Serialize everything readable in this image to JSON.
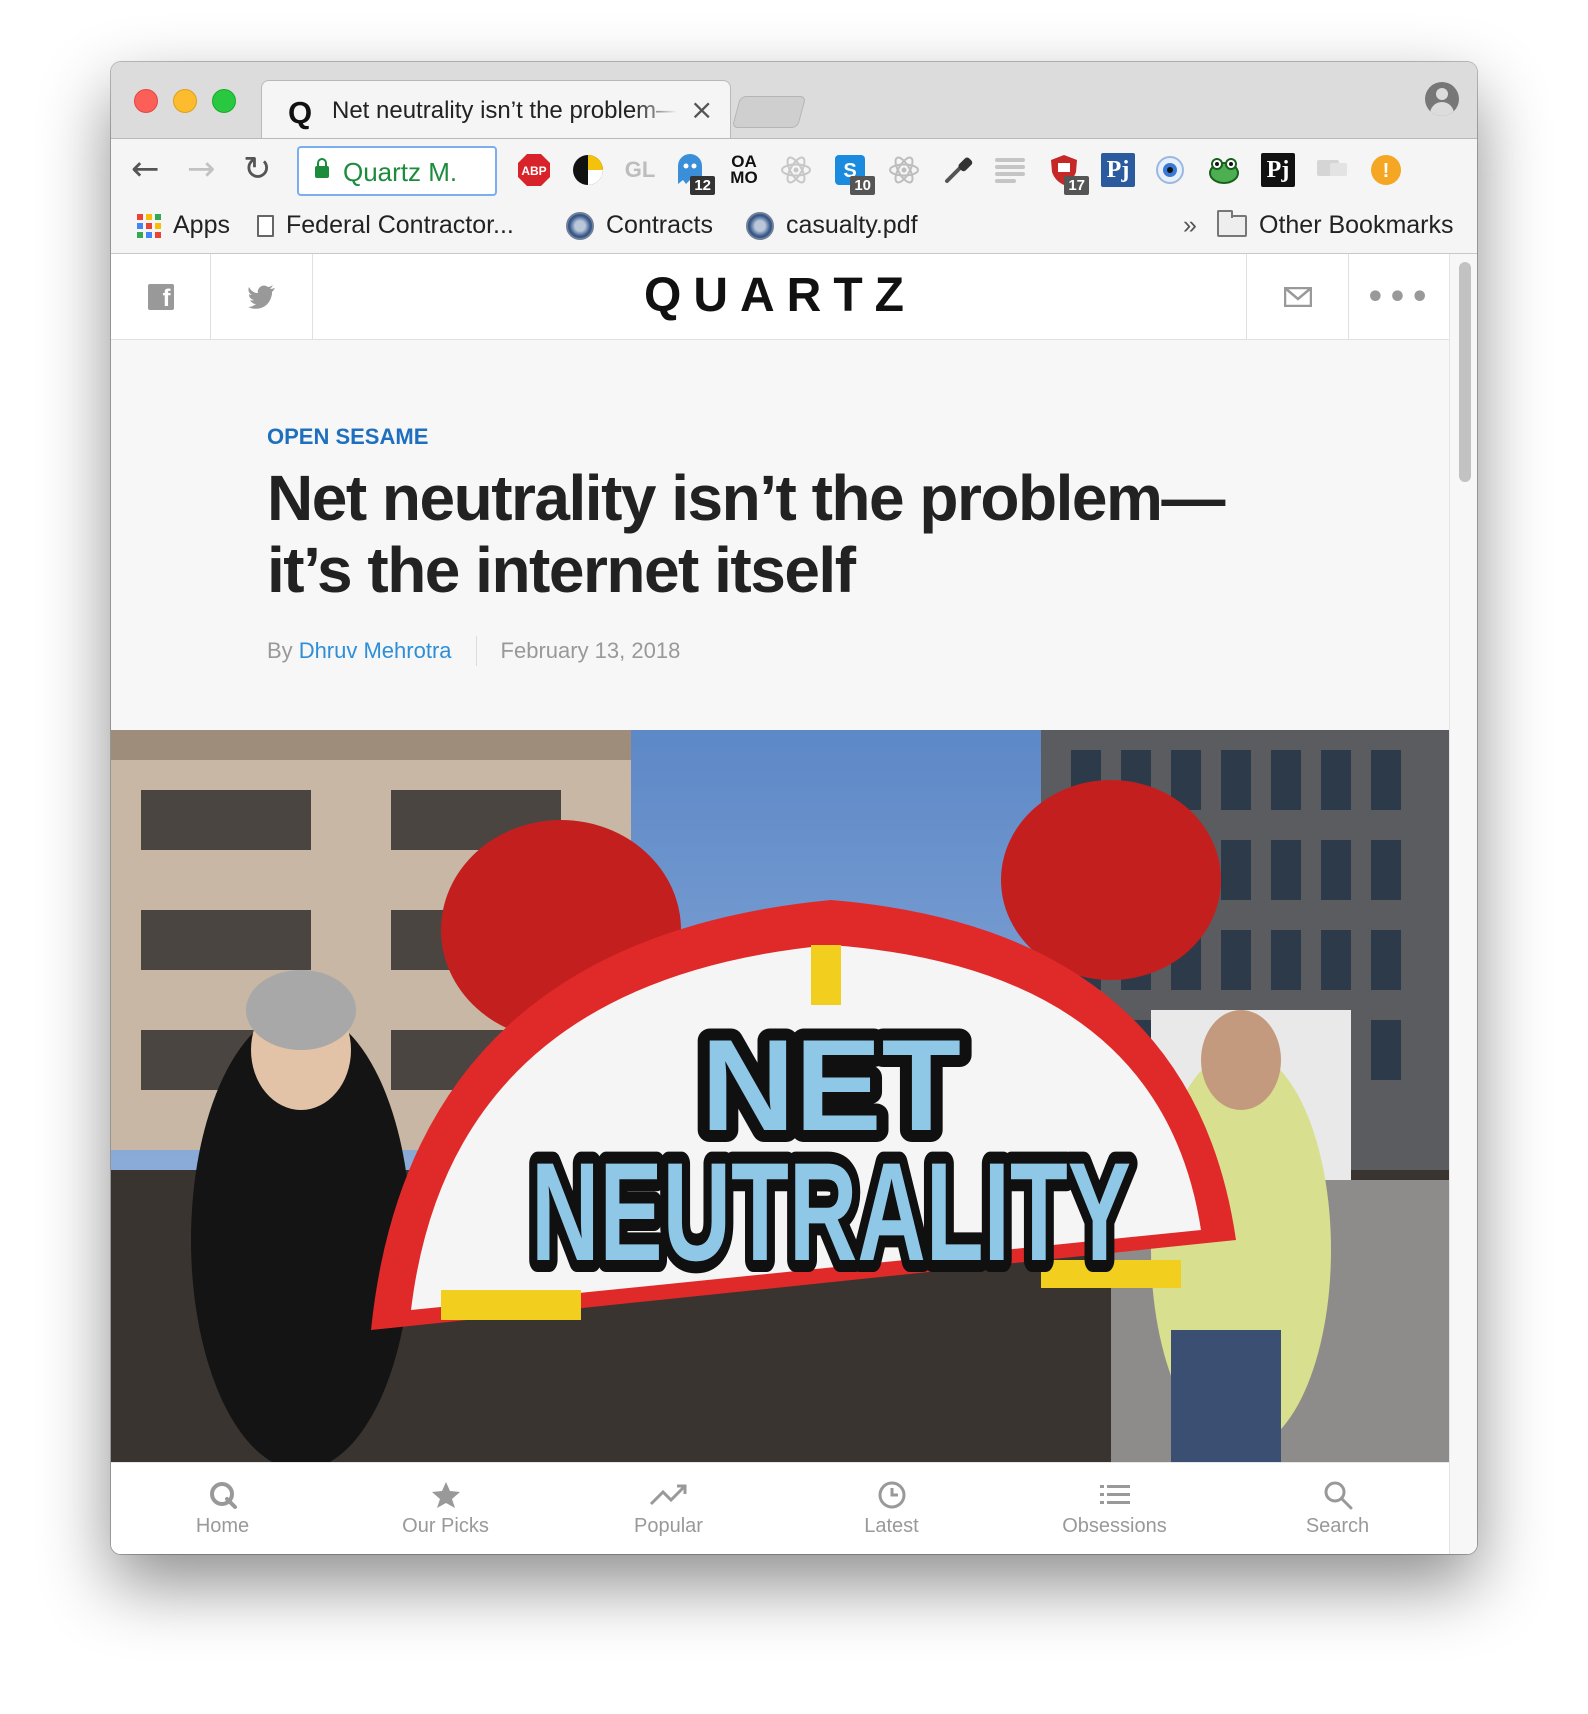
{
  "browser": {
    "tab_title": "Net neutrality isn’t the problem—it’s the internet itself",
    "tab_favicon": "Q",
    "address_text": "Quartz M.",
    "extension_badges": {
      "ext_ghost": "12",
      "ext_s": "10",
      "ext_shield": "17"
    },
    "extension_labels": {
      "abp": "ABP",
      "gl": "GL",
      "oa": "OA",
      "mo": "MO",
      "pj": "Pj",
      "warn": "!"
    },
    "bookmarks": [
      {
        "label": "Apps",
        "icon": "apps-grid-icon"
      },
      {
        "label": "Federal Contractor...",
        "icon": "document-icon"
      },
      {
        "label": "Contracts",
        "icon": "seal-icon"
      },
      {
        "label": "casualty.pdf",
        "icon": "seal-icon"
      }
    ],
    "bookmarks_overflow": "»",
    "other_bookmarks": "Other Bookmarks"
  },
  "site": {
    "logo": "QUARTZ",
    "header_icons": [
      "facebook-icon",
      "twitter-icon",
      "mail-icon",
      "more-icon"
    ]
  },
  "article": {
    "kicker": "OPEN SESAME",
    "headline": "Net neutrality isn’t the problem—it’s the internet itself",
    "by_prefix": "By",
    "author": "Dhruv Mehrotra",
    "date": "February 13, 2018",
    "hero_sign_line1": "NET",
    "hero_sign_line2": "NEUTRALITY"
  },
  "bottom_nav": [
    {
      "label": "Home",
      "icon": "quartz-q-icon"
    },
    {
      "label": "Our Picks",
      "icon": "star-icon"
    },
    {
      "label": "Popular",
      "icon": "trending-icon"
    },
    {
      "label": "Latest",
      "icon": "clock-icon"
    },
    {
      "label": "Obsessions",
      "icon": "list-icon"
    },
    {
      "label": "Search",
      "icon": "search-icon"
    }
  ],
  "colors": {
    "kicker": "#1f6fbf",
    "author_link": "#2e8ed8",
    "secure_green": "#1c8c3c"
  }
}
